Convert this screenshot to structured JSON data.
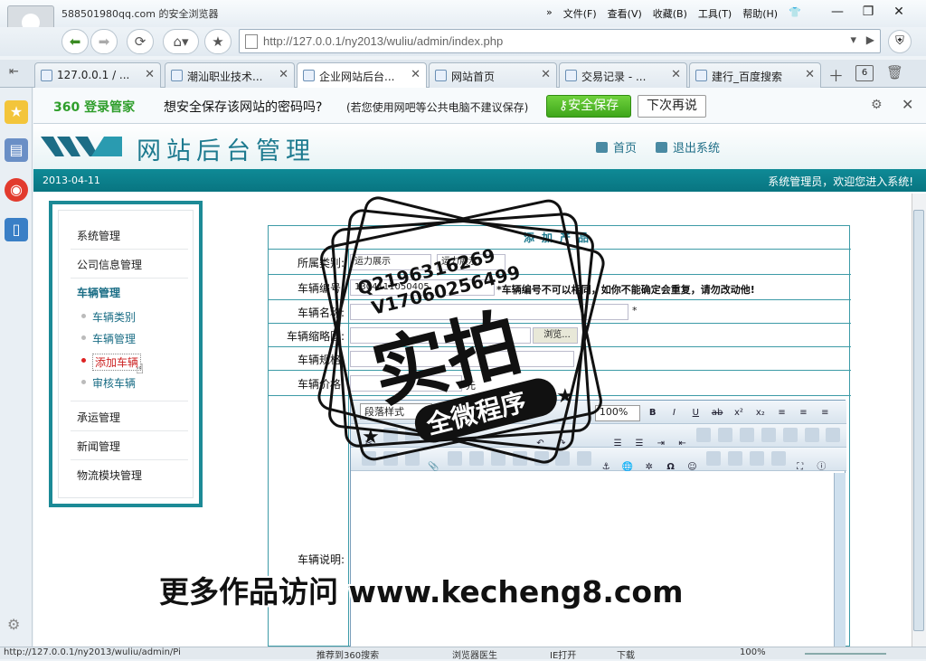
{
  "window": {
    "title": "588501980qq.com 的安全浏览器",
    "menu": [
      "文件(F)",
      "查看(V)",
      "收藏(B)",
      "工具(T)",
      "帮助(H)"
    ]
  },
  "nav": {
    "url": "http://127.0.0.1/ny2013/wuliu/admin/index.php"
  },
  "tabs": [
    {
      "label": "127.0.0.1 / ..."
    },
    {
      "label": "潮汕职业技术..."
    },
    {
      "label": "企业网站后台..."
    },
    {
      "label": "网站首页"
    },
    {
      "label": "交易记录 - ..."
    },
    {
      "label": "建行_百度搜索"
    }
  ],
  "tab_count": "6",
  "pwbar": {
    "brand": "360 登录管家",
    "question": "想安全保存该网站的密码吗?",
    "note": "(若您使用网吧等公共电脑不建议保存)",
    "save": "安全保存",
    "later": "下次再说"
  },
  "site": {
    "title": "网站后台管理",
    "home": "首页",
    "logout": "退出系统",
    "date": "2013-04-11",
    "welcome": "系统管理员，欢迎您进入系统!"
  },
  "menu": {
    "items": [
      "系统管理",
      "公司信息管理",
      "车辆管理",
      "承运管理",
      "新闻管理",
      "物流模块管理"
    ],
    "sub": [
      "车辆类别",
      "车辆管理",
      "添加车辆",
      "审核车辆"
    ]
  },
  "form": {
    "title": "添加产品",
    "labels": {
      "category": "所属类别:",
      "number": "车辆编号:",
      "name": "车辆名称:",
      "thumb": "车辆缩略图:",
      "spec": "车辆规格:",
      "price": "车辆价格:",
      "desc": "车辆说明:"
    },
    "category_value": "运力展示",
    "category_sub": "运力展示",
    "number_value": "1304111050405",
    "number_hint": "*车辆编号不可以相同，如你不能确定会重复，请勿改动他!",
    "name_req": "*",
    "upload": "浏览...",
    "price_unit": "元"
  },
  "editor": {
    "paragraph": "段落样式",
    "zoom": "100%"
  },
  "statusbar": {
    "url": "http://127.0.0.1/ny2013/wuliu/admin/Pi",
    "recommend": "推荐到360搜索",
    "doctor": "浏览器医生",
    "ie": "IE打开",
    "download": "下载",
    "zoom": "100%"
  },
  "stamp": {
    "qq": "Q2196316269",
    "v": "V17060256499",
    "big": "实拍",
    "small": "全微程序"
  },
  "watermark": "更多作品访问 www.kecheng8.com"
}
